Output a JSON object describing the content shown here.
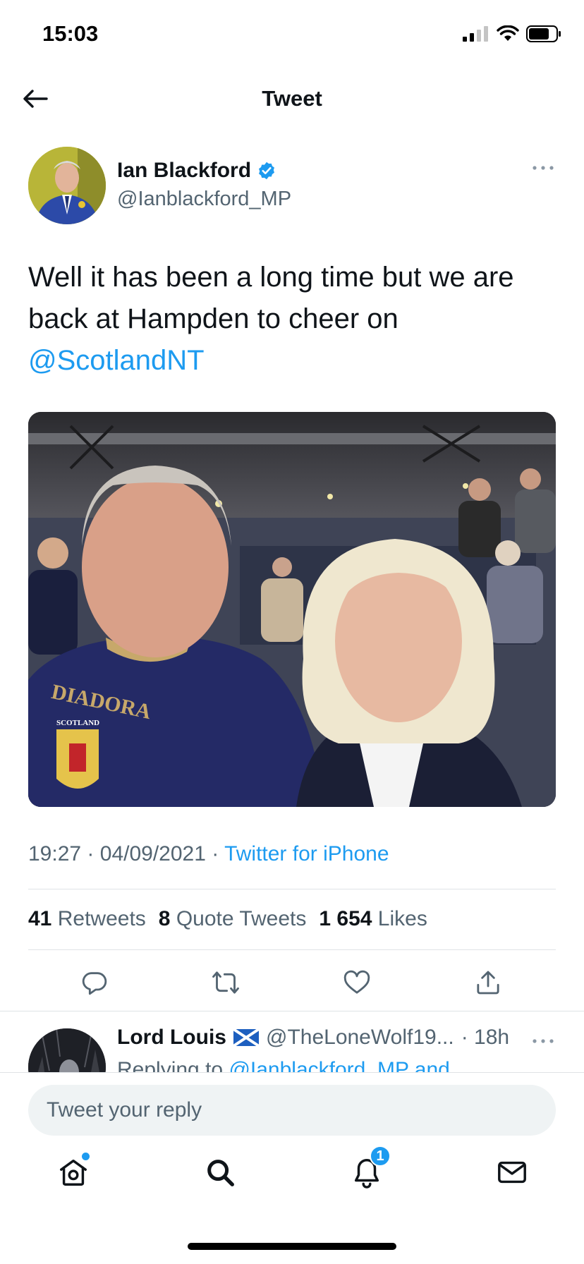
{
  "status_bar": {
    "time": "15:03"
  },
  "nav": {
    "title": "Tweet"
  },
  "tweet": {
    "author_name": "Ian Blackford",
    "author_handle": "@Ianblackford_MP",
    "text_line": "Well it has been a long time but we are back at Hampden to cheer on ",
    "mention": "@ScotlandNT",
    "photo_text": {
      "shirt_brand": "DIADORA",
      "crest_text": "SCOTLAND"
    },
    "time": "19:27",
    "date": "04/09/2021",
    "source": "Twitter for iPhone",
    "separator": "·",
    "stats": {
      "retweets_count": "41",
      "retweets_label": "Retweets",
      "quotes_count": "8",
      "quotes_label": "Quote Tweets",
      "likes_count": "1 654",
      "likes_label": "Likes"
    }
  },
  "reply_preview": {
    "name": "Lord Louis",
    "flag": "🏴󠁧󠁢󠁳󠁣󠁴󠁿",
    "handle": "@TheLoneWolf19...",
    "age": "· 18h",
    "context_prefix": "Replying to ",
    "context_link": "@Ianblackford_MP and"
  },
  "compose": {
    "placeholder": "Tweet your reply"
  },
  "tabbar": {
    "notifications_count": "1"
  },
  "colors": {
    "accent": "#1d9bf0",
    "text": "#0f1419",
    "muted": "#536471"
  },
  "icons": [
    "back-arrow-icon",
    "verified-icon",
    "more-icon",
    "reply-icon",
    "retweet-icon",
    "like-icon",
    "share-icon",
    "home-icon",
    "search-icon",
    "notifications-icon",
    "messages-icon"
  ]
}
